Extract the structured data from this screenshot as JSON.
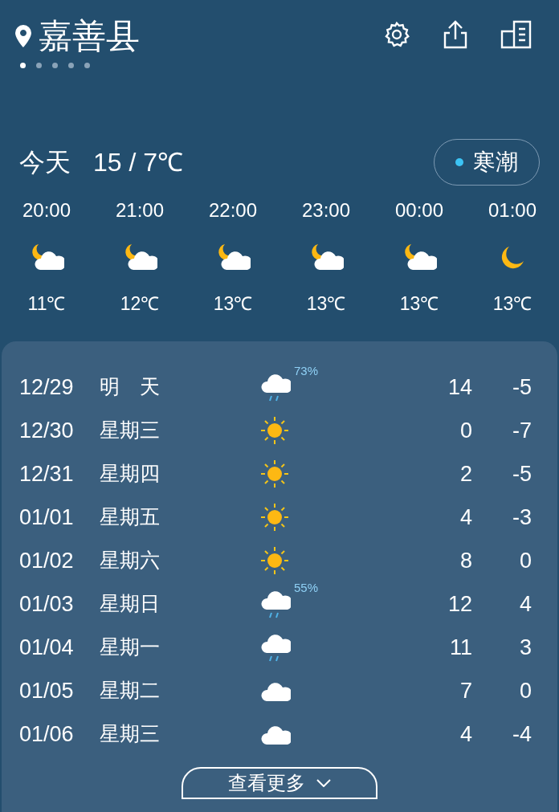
{
  "header": {
    "city": "嘉善县",
    "pages": [
      {
        "selected": true
      },
      {
        "selected": false
      },
      {
        "selected": false
      },
      {
        "selected": false
      },
      {
        "selected": false
      }
    ]
  },
  "today": {
    "label": "今天",
    "temps": "15 / 7℃",
    "alert": {
      "label": "寒潮",
      "color": "#3cc4f5"
    }
  },
  "hourly": [
    {
      "time": "20:00",
      "kind": "night-cloudy",
      "temp": "11℃"
    },
    {
      "time": "21:00",
      "kind": "night-cloudy",
      "temp": "12℃"
    },
    {
      "time": "22:00",
      "kind": "night-cloudy",
      "temp": "13℃"
    },
    {
      "time": "23:00",
      "kind": "night-cloudy",
      "temp": "13℃"
    },
    {
      "time": "00:00",
      "kind": "night-cloudy",
      "temp": "13℃"
    },
    {
      "time": "01:00",
      "kind": "moon",
      "temp": "13℃"
    }
  ],
  "daily": [
    {
      "date": "12/29",
      "day": "明　天",
      "kind": "rain",
      "chance": "73%",
      "high": "14",
      "low": "-5"
    },
    {
      "date": "12/30",
      "day": "星期三",
      "kind": "sun",
      "high": "0",
      "low": "-7"
    },
    {
      "date": "12/31",
      "day": "星期四",
      "kind": "sun",
      "high": "2",
      "low": "-5"
    },
    {
      "date": "01/01",
      "day": "星期五",
      "kind": "sun",
      "high": "4",
      "low": "-3"
    },
    {
      "date": "01/02",
      "day": "星期六",
      "kind": "sun",
      "high": "8",
      "low": "0"
    },
    {
      "date": "01/03",
      "day": "星期日",
      "kind": "rain",
      "chance": "55%",
      "high": "12",
      "low": "4"
    },
    {
      "date": "01/04",
      "day": "星期一",
      "kind": "rain",
      "high": "11",
      "low": "3"
    },
    {
      "date": "01/05",
      "day": "星期二",
      "kind": "cloud",
      "high": "7",
      "low": "0"
    },
    {
      "date": "01/06",
      "day": "星期三",
      "kind": "cloud",
      "high": "4",
      "low": "-4"
    }
  ],
  "more_button": "查看更多"
}
